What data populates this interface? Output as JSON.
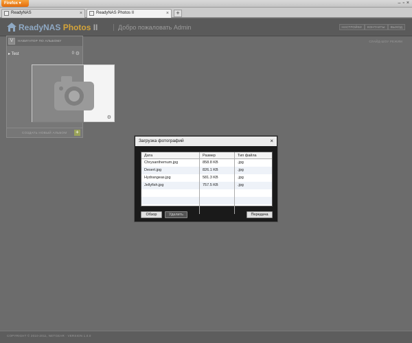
{
  "browser": {
    "menu_label": "Firefox",
    "tabs": [
      {
        "label": "ReadyNAS"
      },
      {
        "label": "ReadyNAS Photos II"
      }
    ],
    "new_tab": "+",
    "controls": {
      "minimize": "–",
      "maximize": "▫",
      "close": "×"
    }
  },
  "header": {
    "brand_ready": "ReadyNAS",
    "brand_photos": "Photos",
    "brand_version": "II",
    "welcome": "Добро пожаловать Admin",
    "links": [
      "НАСТРОЙКИ",
      "КОНТАКТЫ",
      "ВЫХОД"
    ]
  },
  "album_panel": {
    "collapse_label": "V",
    "title": "НАВИГАТОР ПО АЛЬБОМУ",
    "album": {
      "name": "▸ Test",
      "count": "0"
    },
    "create_label": "СОЗДАТЬ НОВЫЙ АЛЬБОМ",
    "add_label": "+"
  },
  "main": {
    "side_link": "СЛАЙД-ШОУ РЕЖИМ"
  },
  "upload_dialog": {
    "title": "Загрузка фотографий",
    "close": "×",
    "columns": [
      "Дата",
      "Размер",
      "Тип файла"
    ],
    "rows": [
      {
        "name": "Chrysanthemum.jpg",
        "size": "858.8 KB",
        "type": ".jpg"
      },
      {
        "name": "Desert.jpg",
        "size": "826.1 KB",
        "type": ".jpg"
      },
      {
        "name": "Hydrangeas.jpg",
        "size": "581.3 KB",
        "type": ".jpg"
      },
      {
        "name": "Jellyfish.jpg",
        "size": "757.5 KB",
        "type": ".jpg"
      }
    ],
    "browse_label": "Обзор",
    "delete_label": "Удалить",
    "upload_label": "Передача"
  },
  "footer": {
    "text": "COPYRIGHT © 2010-2011, NETGEAR · VERSION 1.0.0"
  },
  "colors": {
    "background": "#6c6c6c",
    "brand_blue": "#8fa9c4",
    "brand_gold": "#d4a43a",
    "firefox_orange": "#e36d0c",
    "add_button": "#9aa35a"
  }
}
